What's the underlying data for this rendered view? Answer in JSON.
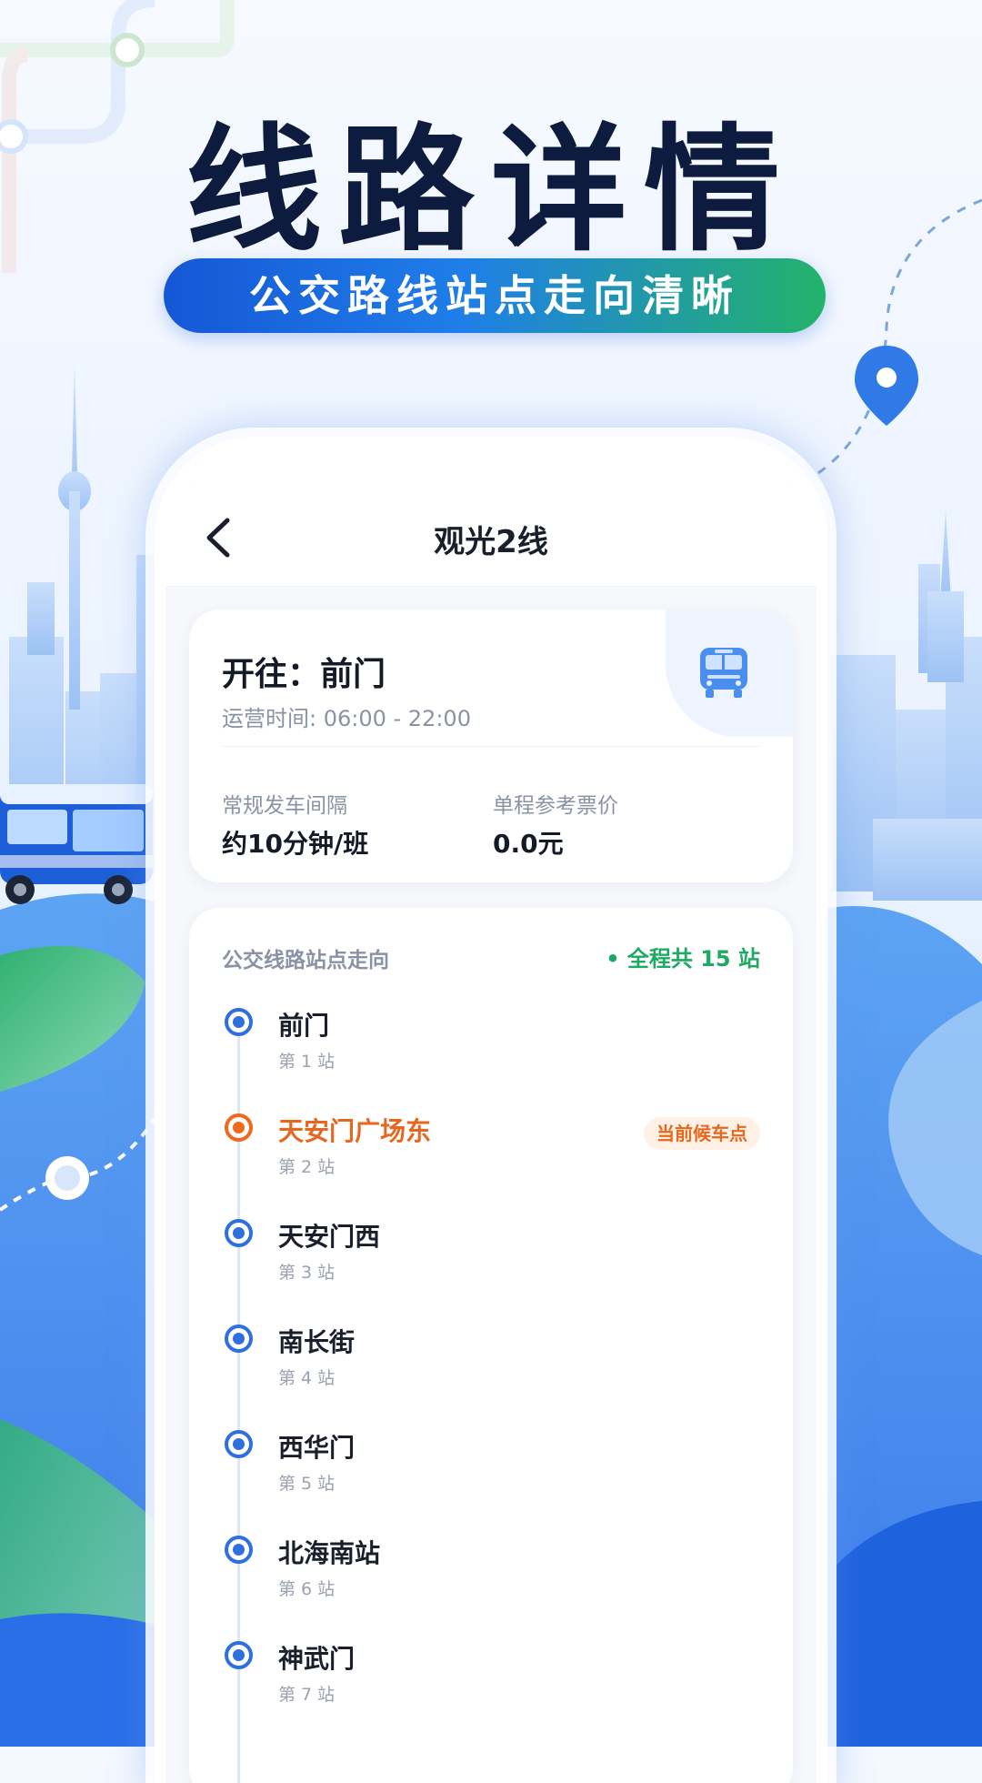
{
  "hero": {
    "title": "线路详情",
    "subtitle": "公交路线站点走向清晰"
  },
  "app": {
    "header": {
      "title": "观光2线"
    },
    "route_info": {
      "destination": "开往：前门",
      "hours": "运营时间: 06:00 - 22:00",
      "interval_label": "常规发车间隔",
      "interval_value": "约10分钟/班",
      "fare_label": "单程参考票价",
      "fare_value": "0.0元"
    },
    "stops_section": {
      "heading": "公交线路站点走向",
      "total": "• 全程共 15 站",
      "current_badge": "当前候车点",
      "stops": [
        {
          "name": "前门",
          "number": "第 1 站"
        },
        {
          "name": "天安门广场东",
          "number": "第 2 站"
        },
        {
          "name": "天安门西",
          "number": "第 3 站"
        },
        {
          "name": "南长街",
          "number": "第 4 站"
        },
        {
          "name": "西华门",
          "number": "第 5 站"
        },
        {
          "name": "北海南站",
          "number": "第 6 站"
        },
        {
          "name": "神武门",
          "number": "第 7 站"
        }
      ]
    }
  },
  "colors": {
    "accent": "#2f6fe0",
    "current": "#e8671e",
    "total_green": "#1daa62",
    "title_navy": "#0d1b3e"
  },
  "icons": [
    "back-arrow-icon",
    "bus-icon",
    "location-pin-icon"
  ]
}
